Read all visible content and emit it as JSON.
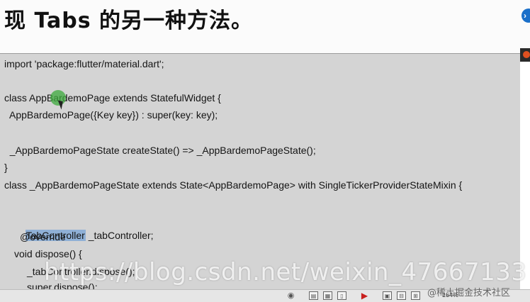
{
  "slide": {
    "title": "现 Tabs 的另一种方法。"
  },
  "code": {
    "lines": [
      "import 'package:flutter/material.dart';",
      "class AppBardemoPage extends StatefulWidget {",
      "  AppBardemoPage({Key key}) : super(key: key);",
      "  _AppBardemoPageState createState() => _AppBardemoPageState();",
      "}",
      "class _AppBardemoPageState extends State<AppBardemoPage> with SingleTickerProviderStateMixin {",
      "TabController",
      " _tabController;",
      "@override",
      "void dispose() {",
      "_tabController.dispose();",
      "super.dispose();"
    ]
  },
  "watermark": "https://blog.csdn.net/weixin_47667133",
  "status_bar": {
    "zoom": "164%",
    "badge": "@稀土掘金技术社区",
    "icons": [
      "eye-icon",
      "normal-view-icon",
      "slide-sorter-icon",
      "reading-view-icon",
      "slideshow-icon",
      "fit-icon",
      "zoom-out-icon",
      "zoom-in-icon"
    ]
  },
  "colors": {
    "code_bg": "#d4d4d4",
    "highlight": "#8fb0d6",
    "cursor": "#3caa3c"
  }
}
